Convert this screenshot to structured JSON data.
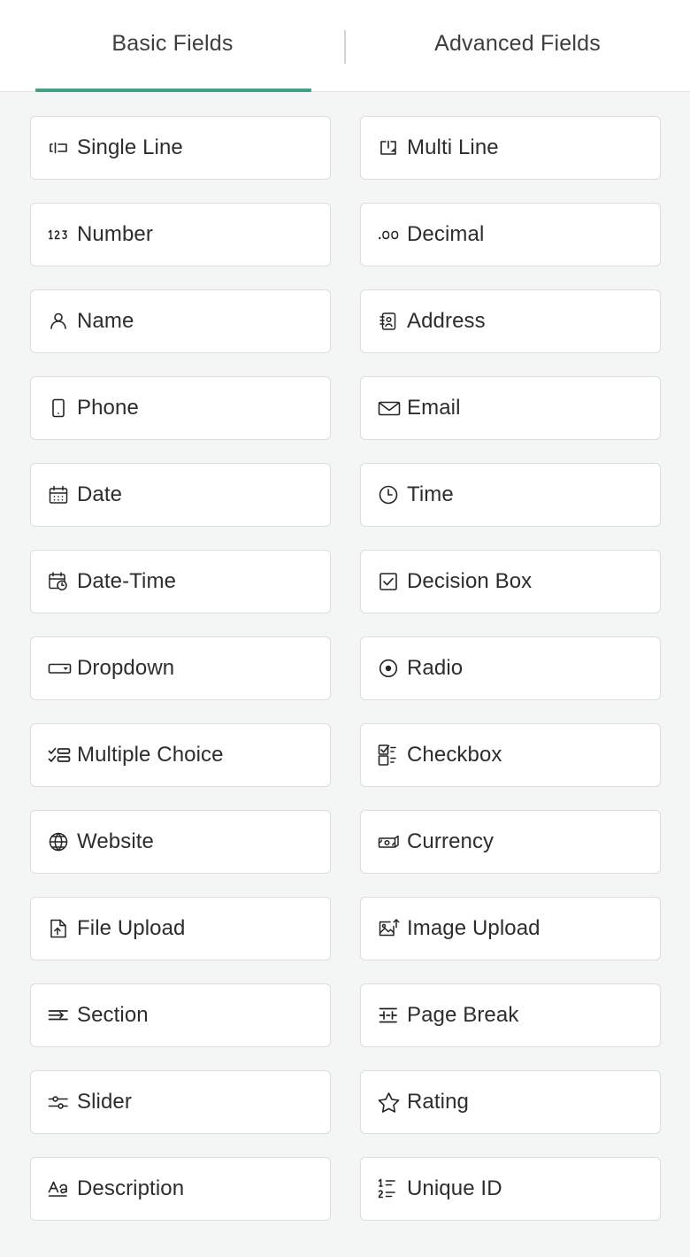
{
  "tabs": [
    {
      "label": "Basic Fields",
      "active": true
    },
    {
      "label": "Advanced Fields",
      "active": false
    }
  ],
  "colors": {
    "active_tab_underline": "#41a086",
    "page_background": "#f4f5f5",
    "card_background": "#ffffff",
    "card_border": "#dcdede",
    "label_text": "#2b2d2f",
    "tab_text": "#3c3f41",
    "divider": "#cfd2d2"
  },
  "fields": [
    {
      "label": "Single Line",
      "icon": "single-line-icon"
    },
    {
      "label": "Multi Line",
      "icon": "multi-line-icon"
    },
    {
      "label": "Number",
      "icon": "number-123-icon"
    },
    {
      "label": "Decimal",
      "icon": "decimal-point-zero-zero-icon"
    },
    {
      "label": "Name",
      "icon": "person-icon"
    },
    {
      "label": "Address",
      "icon": "address-book-icon"
    },
    {
      "label": "Phone",
      "icon": "mobile-phone-icon"
    },
    {
      "label": "Email",
      "icon": "envelope-icon"
    },
    {
      "label": "Date",
      "icon": "calendar-icon"
    },
    {
      "label": "Time",
      "icon": "clock-icon"
    },
    {
      "label": "Date-Time",
      "icon": "calendar-clock-icon"
    },
    {
      "label": "Decision Box",
      "icon": "checked-box-icon"
    },
    {
      "label": "Dropdown",
      "icon": "dropdown-select-icon"
    },
    {
      "label": "Radio",
      "icon": "radio-button-icon"
    },
    {
      "label": "Multiple Choice",
      "icon": "checklist-icon"
    },
    {
      "label": "Checkbox",
      "icon": "checkbox-list-icon"
    },
    {
      "label": "Website",
      "icon": "globe-icon"
    },
    {
      "label": "Currency",
      "icon": "banknote-icon"
    },
    {
      "label": "File Upload",
      "icon": "file-upload-icon"
    },
    {
      "label": "Image Upload",
      "icon": "image-upload-icon"
    },
    {
      "label": "Section",
      "icon": "section-break-icon"
    },
    {
      "label": "Page Break",
      "icon": "page-break-icon"
    },
    {
      "label": "Slider",
      "icon": "slider-controls-icon"
    },
    {
      "label": "Rating",
      "icon": "star-icon"
    },
    {
      "label": "Description",
      "icon": "text-aa-icon"
    },
    {
      "label": "Unique ID",
      "icon": "numbered-list-icon"
    }
  ]
}
